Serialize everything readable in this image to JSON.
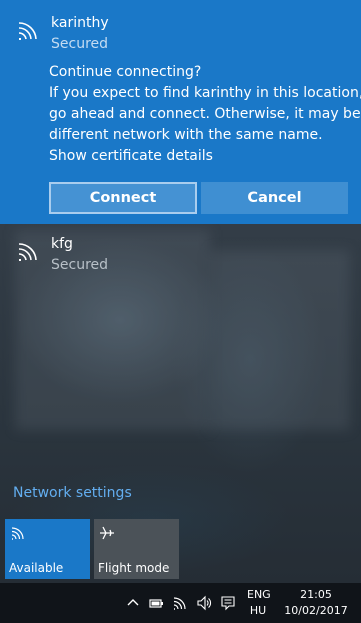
{
  "expanded_network": {
    "name": "karinthy",
    "status": "Secured",
    "prompt_title": "Continue connecting?",
    "prompt_lines": [
      "If you expect to find karinthy in this location,",
      "go ahead and connect. Otherwise, it may be a",
      "different network with the same name."
    ],
    "certificate_link": "Show certificate details",
    "connect_label": "Connect",
    "cancel_label": "Cancel"
  },
  "other_networks": [
    {
      "name": "kfg",
      "status": "Secured"
    }
  ],
  "network_settings_label": "Network settings",
  "quick_actions": [
    {
      "label": "Available",
      "icon": "wifi-icon",
      "active": true
    },
    {
      "label": "Flight mode",
      "icon": "airplane-icon",
      "active": false
    }
  ],
  "taskbar": {
    "lang_top": "ENG",
    "lang_bottom": "HU",
    "time": "21:05",
    "date": "10/02/2017",
    "tray_icons": [
      "chevron-up-icon",
      "battery-icon",
      "wifi-icon",
      "volume-icon",
      "action-center-icon"
    ]
  },
  "colors": {
    "accent": "#1a78c8",
    "link": "#63aef0",
    "taskbar": "#101419"
  }
}
